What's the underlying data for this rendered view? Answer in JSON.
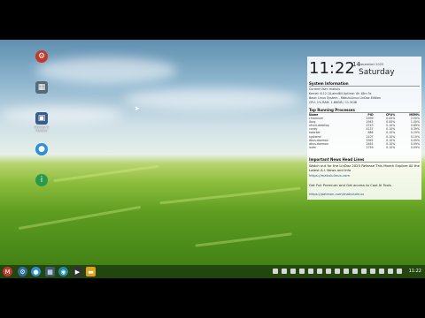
{
  "desktop_icons": [
    {
      "name": "desktop-icon-settings",
      "glyph": "⚙",
      "color": "#c0392b",
      "label": ""
    },
    {
      "name": "desktop-icon-theme",
      "glyph": "▦",
      "color": "#556b7a",
      "label": ""
    },
    {
      "name": "desktop-icon-display",
      "glyph": "▣",
      "color": "#3a5c8c",
      "label": "Display & Monitor"
    },
    {
      "name": "desktop-icon-browser",
      "glyph": "●",
      "color": "#2d8fd6",
      "label": ""
    },
    {
      "name": "desktop-icon-help",
      "glyph": "i",
      "color": "#2a9a4a",
      "label": ""
    }
  ],
  "widget": {
    "time": "11:22",
    "day": "14",
    "month": "December 2025",
    "weekday": "Saturday",
    "system_title": "System Information",
    "sys_lines": [
      "Current User: makulu",
      "Kernel: 6.12.10-amd64    Uptime: 0h 18m 5s",
      "Base: Linux System - MakuluLinux LinDoz Edition",
      "CPU: 1%    RAM: 1.68GiB / 11.5GiB"
    ],
    "proc_title": "Top Running Processes",
    "proc_headers": [
      "Name",
      "PID",
      "CPU%",
      "MEM%"
    ],
    "processes": [
      [
        "chromium",
        "2399",
        "0.00%",
        "2.50%"
      ],
      [
        "Xorg",
        "1945",
        "0.00%",
        "1.00%"
      ],
      [
        "xfce4-desktop",
        "2743",
        "0.10%",
        "0.89%"
      ],
      [
        "conky",
        "4137",
        "0.10%",
        "0.39%"
      ],
      [
        "kworker",
        "886",
        "0.10%",
        "0.19%"
      ],
      [
        "systemd",
        "2107",
        "0.10%",
        "0.10%"
      ],
      [
        "dbus-daemon",
        "2561",
        "0.10%",
        "0.09%"
      ],
      [
        "dbus-daemon",
        "2461",
        "0.10%",
        "0.09%"
      ],
      [
        "lxdm",
        "2759",
        "0.10%",
        "0.09%"
      ]
    ],
    "news_title": "Important News Head Lines",
    "news_1": "Watch out for the LinDoz 2025 Release This Month Explore All the Latest A.I. News and Info",
    "news_link_1": "https://makululinux.com",
    "news_2": "Get Full Premium and Get access to Cool AI Tools",
    "news_link_2": "https://patreon.com/makululinux"
  },
  "taskbar": {
    "apps": [
      {
        "name": "start-menu-button",
        "glyph": "M",
        "color": "#c0392b"
      },
      {
        "name": "taskbar-app-settings",
        "glyph": "⚙",
        "color": "#2f6e9e"
      },
      {
        "name": "taskbar-app-browser",
        "glyph": "●",
        "color": "#2d8fd6"
      },
      {
        "name": "taskbar-app-files",
        "glyph": "▦",
        "color": "#3d5a73"
      },
      {
        "name": "taskbar-app-software",
        "glyph": "◉",
        "color": "#1f8aa8"
      },
      {
        "name": "taskbar-app-terminal",
        "glyph": "▶",
        "color": "#333333"
      },
      {
        "name": "taskbar-app-folder",
        "glyph": "▬",
        "color": "#e0a21b"
      }
    ],
    "clock": "11:22"
  }
}
